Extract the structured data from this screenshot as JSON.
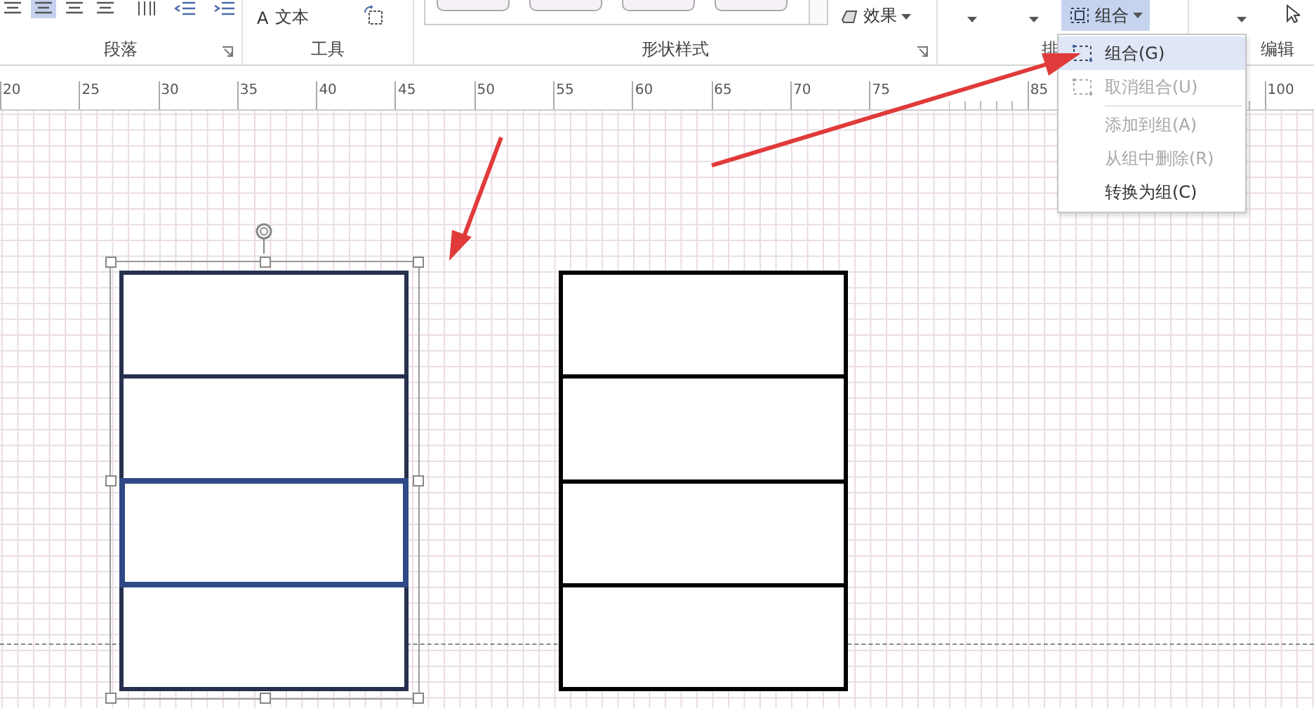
{
  "ribbon": {
    "paragraph": {
      "label": "段落",
      "align_buttons": [
        {
          "selected": false
        },
        {
          "selected": true
        },
        {
          "selected": false
        },
        {
          "selected": false
        }
      ]
    },
    "tools": {
      "label": "工具",
      "text_tool_icon": "A",
      "text_tool": "文本"
    },
    "shape_styles": {
      "label": "形状样式",
      "effects_button": "效果"
    },
    "arrange": {
      "label": "排",
      "group_button": {
        "label": "组合",
        "selected": true
      }
    },
    "edit": {
      "label": "编辑"
    }
  },
  "ruler": {
    "runs": [
      [
        "20",
        "25",
        "30",
        "35",
        "40",
        "45",
        "50",
        "55",
        "60",
        "65",
        "70",
        "75"
      ],
      [
        "85"
      ],
      [
        "100"
      ]
    ]
  },
  "group_menu": {
    "items": [
      {
        "label": "组合(G)",
        "icon": true,
        "disabled": false,
        "selected": true
      },
      {
        "label": "取消组合(U)",
        "icon": true,
        "disabled": true,
        "selected": false
      },
      {
        "label": "添加到组(A)",
        "icon": false,
        "disabled": true,
        "selected": false
      },
      {
        "label": "从组中删除(R)",
        "icon": false,
        "disabled": true,
        "selected": false
      },
      {
        "label": "转换为组(C)",
        "icon": false,
        "disabled": false,
        "selected": false
      }
    ]
  },
  "canvas": {
    "shape_groups": [
      {
        "selected": true,
        "rows": [
          {
            "highlighted": false
          },
          {
            "highlighted": false
          },
          {
            "highlighted": true
          },
          {
            "highlighted": false
          }
        ]
      },
      {
        "selected": false,
        "rows": [
          {
            "highlighted": false
          },
          {
            "highlighted": false
          },
          {
            "highlighted": false
          },
          {
            "highlighted": false
          }
        ]
      }
    ]
  }
}
